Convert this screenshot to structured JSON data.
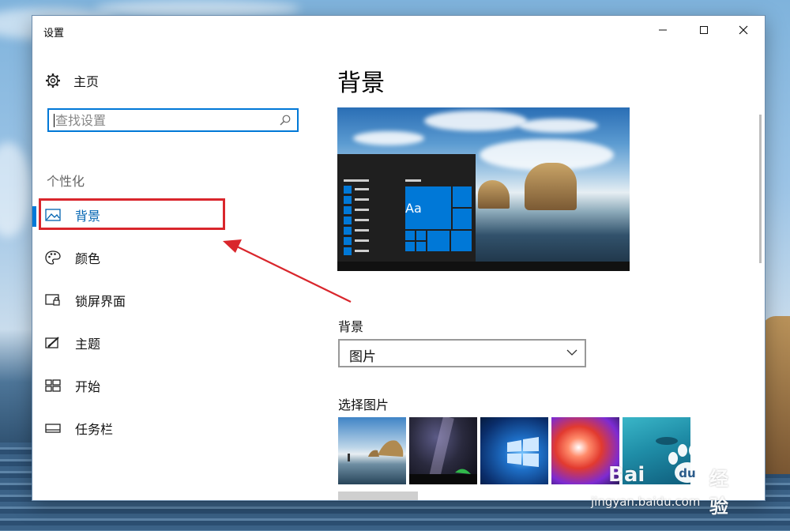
{
  "window": {
    "title": "设置"
  },
  "sidebar": {
    "home_label": "主页",
    "search": {
      "placeholder": "查找设置",
      "value": ""
    },
    "section_label": "个性化",
    "items": [
      {
        "label": "背景",
        "icon": "picture-icon",
        "active": true
      },
      {
        "label": "颜色",
        "icon": "palette-icon",
        "active": false
      },
      {
        "label": "锁屏界面",
        "icon": "lock-screen-icon",
        "active": false
      },
      {
        "label": "主题",
        "icon": "themes-icon",
        "active": false
      },
      {
        "label": "开始",
        "icon": "start-icon",
        "active": false
      },
      {
        "label": "任务栏",
        "icon": "taskbar-icon",
        "active": false
      }
    ]
  },
  "main": {
    "title": "背景",
    "preview": {
      "tile_text": "Aa"
    },
    "background_field": {
      "label": "背景",
      "selected": "图片"
    },
    "choose_picture_label": "选择图片"
  },
  "colors": {
    "accent": "#0078d7",
    "highlight_box": "#d9262c"
  },
  "watermark": {
    "brand": "Bai",
    "brand_suffix": "经验",
    "site": "jingyan.baidu.com"
  }
}
